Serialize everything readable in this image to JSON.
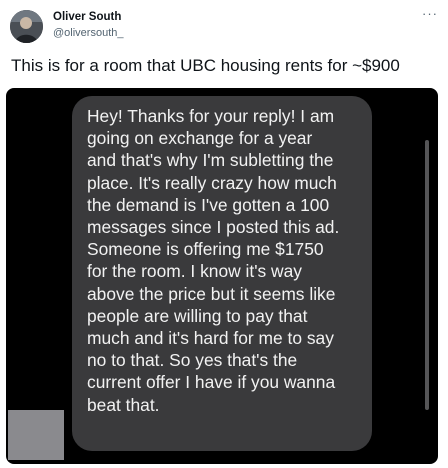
{
  "user": {
    "display_name": "Oliver South",
    "handle": "@oliversouth_",
    "avatar_icon": "profile-photo"
  },
  "menu": {
    "more_label": "···"
  },
  "tweet": {
    "text": "This is for a room that UBC housing rents for ~$900"
  },
  "message": {
    "lines": [
      "Hey! Thanks for your reply! I am",
      "going on exchange for a year",
      "and that's why I'm subletting the",
      "place. It's really crazy how much",
      "the demand is I've gotten a 100",
      "messages since I posted this ad.",
      "Someone is offering me $1750",
      "for the room. I know it's way",
      "above the price but it seems like",
      "people are willing to pay that",
      "much and it's hard for me to say",
      "no to that. So yes that's the",
      "current offer I have if you wanna",
      "beat that."
    ]
  },
  "colors": {
    "media_background": "#000000",
    "bubble_background": "#3a3a3c",
    "bubble_text": "#f2f2f2",
    "handle_gray": "#536471"
  }
}
